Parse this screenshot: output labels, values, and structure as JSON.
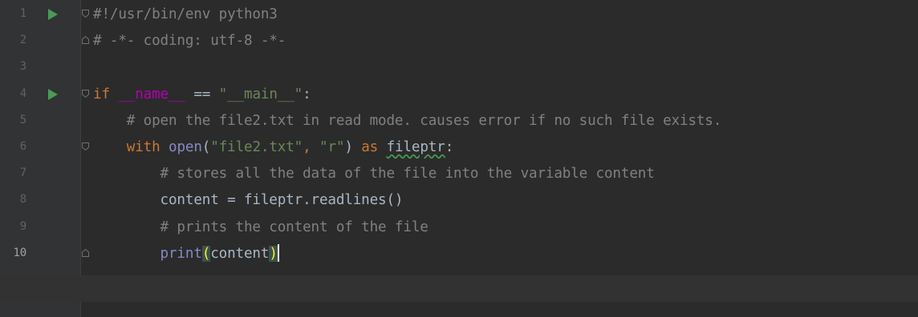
{
  "editor": {
    "current_line": 10,
    "lines": [
      {
        "number": "1",
        "run": true,
        "fold": "start",
        "indent": "",
        "tokens": [
          {
            "t": "#!/usr/bin/env python3",
            "c": "comment"
          }
        ]
      },
      {
        "number": "2",
        "run": false,
        "fold": "end",
        "indent": "",
        "tokens": [
          {
            "t": "# -*- coding: utf-8 -*-",
            "c": "comment"
          }
        ]
      },
      {
        "number": "3",
        "run": false,
        "fold": "",
        "indent": "",
        "tokens": []
      },
      {
        "number": "4",
        "run": true,
        "fold": "start",
        "indent": "",
        "tokens": [
          {
            "t": "if",
            "c": "kw"
          },
          {
            "t": " ",
            "c": ""
          },
          {
            "t": "__name__",
            "c": "dunder"
          },
          {
            "t": " == ",
            "c": ""
          },
          {
            "t": "\"__main__\"",
            "c": "str"
          },
          {
            "t": ":",
            "c": ""
          }
        ]
      },
      {
        "number": "5",
        "run": false,
        "fold": "",
        "indent": "    ",
        "tokens": [
          {
            "t": "# open the file2.txt in read mode. causes error if no such file exists.",
            "c": "comment"
          }
        ]
      },
      {
        "number": "6",
        "run": false,
        "fold": "start",
        "indent": "    ",
        "tokens": [
          {
            "t": "with",
            "c": "kw"
          },
          {
            "t": " ",
            "c": ""
          },
          {
            "t": "open",
            "c": "builtin"
          },
          {
            "t": "(",
            "c": ""
          },
          {
            "t": "\"file2.txt\"",
            "c": "str"
          },
          {
            "t": ", ",
            "c": "kw"
          },
          {
            "t": "\"r\"",
            "c": "str"
          },
          {
            "t": ") ",
            "c": ""
          },
          {
            "t": "as",
            "c": "kw"
          },
          {
            "t": " ",
            "c": ""
          },
          {
            "t": "fileptr",
            "c": "squiggle"
          },
          {
            "t": ":",
            "c": ""
          }
        ]
      },
      {
        "number": "7",
        "run": false,
        "fold": "",
        "indent": "        ",
        "tokens": [
          {
            "t": "# stores all the data of the file into the variable content",
            "c": "comment"
          }
        ]
      },
      {
        "number": "8",
        "run": false,
        "fold": "",
        "indent": "        ",
        "tokens": [
          {
            "t": "content = fileptr.readlines()",
            "c": ""
          }
        ]
      },
      {
        "number": "9",
        "run": false,
        "fold": "",
        "indent": "        ",
        "tokens": [
          {
            "t": "# prints the content of the file",
            "c": "comment"
          }
        ]
      },
      {
        "number": "10",
        "run": false,
        "fold": "end",
        "indent": "        ",
        "tokens": [
          {
            "t": "print",
            "c": "builtin"
          },
          {
            "t": "(",
            "c": "paren-hl"
          },
          {
            "t": "content",
            "c": ""
          },
          {
            "t": ")",
            "c": "paren-hl"
          },
          {
            "t": "",
            "c": "caret"
          }
        ]
      }
    ]
  },
  "colors": {
    "background": "#2b2b2b",
    "gutter": "#313335",
    "comment": "#808080",
    "keyword": "#cc7832",
    "string": "#6a8759",
    "builtin": "#8888c6",
    "dunder": "#b200b2",
    "run_icon": "#499c54"
  }
}
